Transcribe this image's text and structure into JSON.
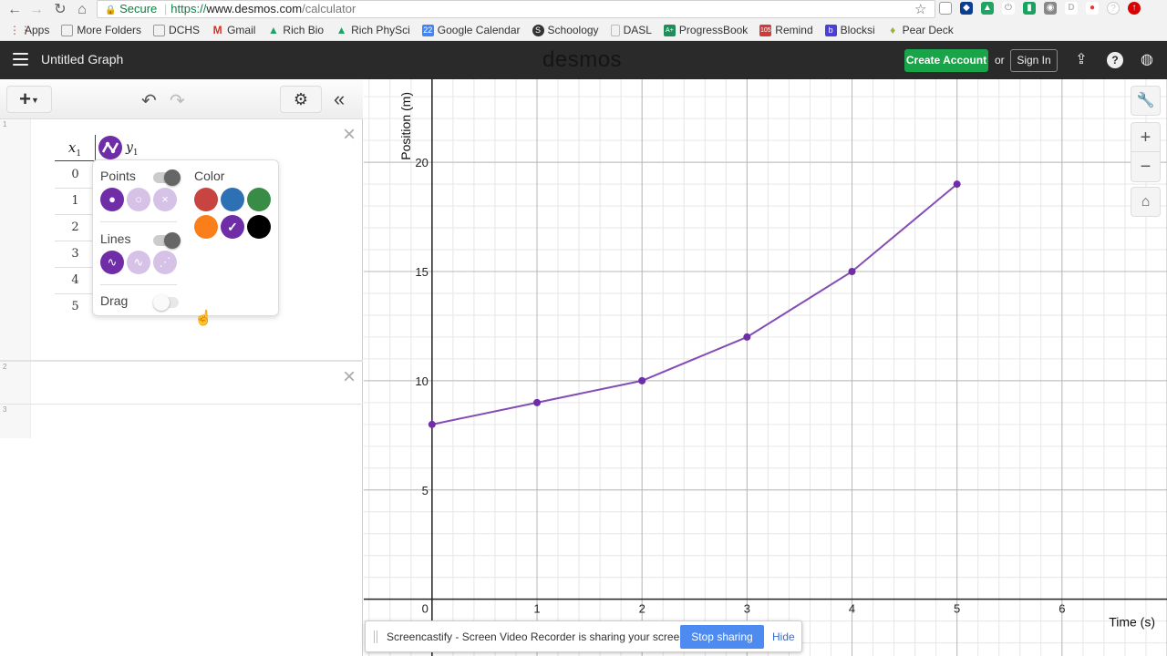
{
  "browser": {
    "secure_label": "Secure",
    "url_scheme": "https://",
    "url_host": "www.desmos.com",
    "url_path": "/calculator",
    "bookmarks": [
      {
        "label": "Apps",
        "icon": "apps-grid-icon",
        "color": "#e04a3b"
      },
      {
        "label": "More Folders",
        "icon": "folder-icon",
        "color": "#999999"
      },
      {
        "label": "DCHS",
        "icon": "folder-icon",
        "color": "#999999"
      },
      {
        "label": "Gmail",
        "icon": "gmail-icon",
        "color": "#d93025"
      },
      {
        "label": "Rich Bio",
        "icon": "google-drive-icon",
        "color": "#1fa463"
      },
      {
        "label": "Rich PhySci",
        "icon": "google-drive-icon",
        "color": "#1fa463"
      },
      {
        "label": "Google Calendar",
        "icon": "calendar-icon",
        "color": "#4285f4",
        "glyph": "22"
      },
      {
        "label": "Schoology",
        "icon": "schoology-icon",
        "color": "#333333",
        "glyph": "S"
      },
      {
        "label": "DASL",
        "icon": "page-icon",
        "color": "#bbbbbb"
      },
      {
        "label": "ProgressBook",
        "icon": "progressbook-icon",
        "color": "#1e8e5a",
        "glyph": "A+"
      },
      {
        "label": "Remind",
        "icon": "remind-icon",
        "color": "#d33a3a",
        "glyph": "105"
      },
      {
        "label": "Blocksi",
        "icon": "blocksi-icon",
        "color": "#4a3fd6",
        "glyph": "b"
      },
      {
        "label": "Pear Deck",
        "icon": "pear-icon",
        "color": "#9cb33a"
      }
    ]
  },
  "header": {
    "graph_title": "Untitled Graph",
    "logo": "desmos",
    "create_account": "Create Account",
    "or": "or",
    "sign_in": "Sign In"
  },
  "expressions": [
    {
      "index": "1",
      "type": "table",
      "col_x": "x",
      "col_x_sub": "1",
      "col_y": "y",
      "col_y_sub": "1",
      "x_values": [
        "0",
        "1",
        "2",
        "3",
        "4",
        "5"
      ],
      "color": "#6f2da8"
    },
    {
      "index": "2",
      "type": "empty"
    },
    {
      "index": "3",
      "type": "empty"
    }
  ],
  "style_popover": {
    "points_label": "Points",
    "points_on": true,
    "lines_label": "Lines",
    "lines_on": true,
    "drag_label": "Drag",
    "drag_on": false,
    "color_label": "Color",
    "colors": [
      "#c74440",
      "#2d70b3",
      "#388c46",
      "#fa7e19",
      "#6f2da8",
      "#000000"
    ],
    "selected_color": "#6f2da8"
  },
  "chart_data": {
    "type": "line",
    "title": "",
    "xlabel": "Time (s)",
    "ylabel": "Position (m)",
    "x": [
      0,
      1,
      2,
      3,
      4,
      5
    ],
    "series": [
      {
        "name": "y1",
        "values": [
          8,
          9,
          10,
          12,
          15,
          19
        ],
        "color": "#6f2da8"
      }
    ],
    "xlim": [
      -0.65,
      7.0
    ],
    "ylim": [
      -2.6,
      23.8
    ],
    "x_ticks": [
      0,
      1,
      2,
      3,
      4,
      5,
      6
    ],
    "y_ticks": [
      5,
      10,
      15,
      20
    ],
    "x_minor_step": 0.2,
    "y_minor_step": 1,
    "grid": true
  },
  "share_bar": {
    "message": "Screencastify - Screen Video Recorder is sharing your screen.",
    "stop_label": "Stop sharing",
    "hide_label": "Hide"
  }
}
